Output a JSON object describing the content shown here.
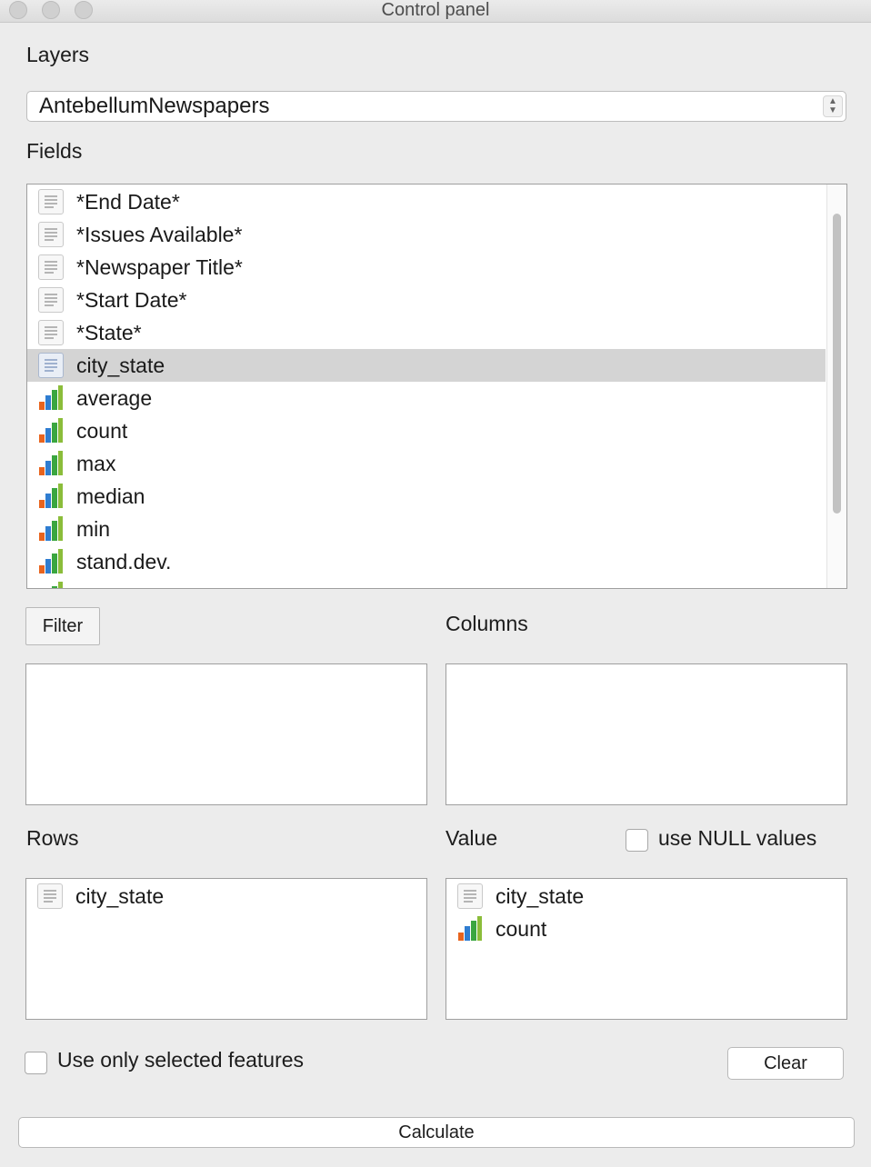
{
  "window": {
    "title": "Control panel"
  },
  "layers": {
    "label": "Layers",
    "selected": "AntebellumNewspapers"
  },
  "fields": {
    "label": "Fields",
    "items": [
      {
        "label": "*End Date*",
        "icon": "text-field-icon"
      },
      {
        "label": "*Issues Available*",
        "icon": "text-field-icon"
      },
      {
        "label": "*Newspaper Title*",
        "icon": "text-field-icon"
      },
      {
        "label": "*Start Date*",
        "icon": "text-field-icon"
      },
      {
        "label": "*State*",
        "icon": "text-field-icon"
      },
      {
        "label": "city_state",
        "icon": "text-field-icon",
        "selected": true
      },
      {
        "label": "average",
        "icon": "numeric-field-icon"
      },
      {
        "label": "count",
        "icon": "numeric-field-icon"
      },
      {
        "label": "max",
        "icon": "numeric-field-icon"
      },
      {
        "label": "median",
        "icon": "numeric-field-icon"
      },
      {
        "label": "min",
        "icon": "numeric-field-icon"
      },
      {
        "label": "stand.dev.",
        "icon": "numeric-field-icon"
      }
    ]
  },
  "filter": {
    "button_label": "Filter"
  },
  "columns": {
    "label": "Columns"
  },
  "rows": {
    "label": "Rows",
    "items": [
      {
        "label": "city_state",
        "icon": "text-field-icon"
      }
    ]
  },
  "value": {
    "label": "Value",
    "use_null_label": "use NULL values",
    "use_null_checked": false,
    "items": [
      {
        "label": "city_state",
        "icon": "text-field-icon"
      },
      {
        "label": "count",
        "icon": "numeric-field-icon"
      }
    ]
  },
  "selection": {
    "label": "Use only selected features",
    "checked": false
  },
  "buttons": {
    "clear": "Clear",
    "calculate": "Calculate"
  }
}
